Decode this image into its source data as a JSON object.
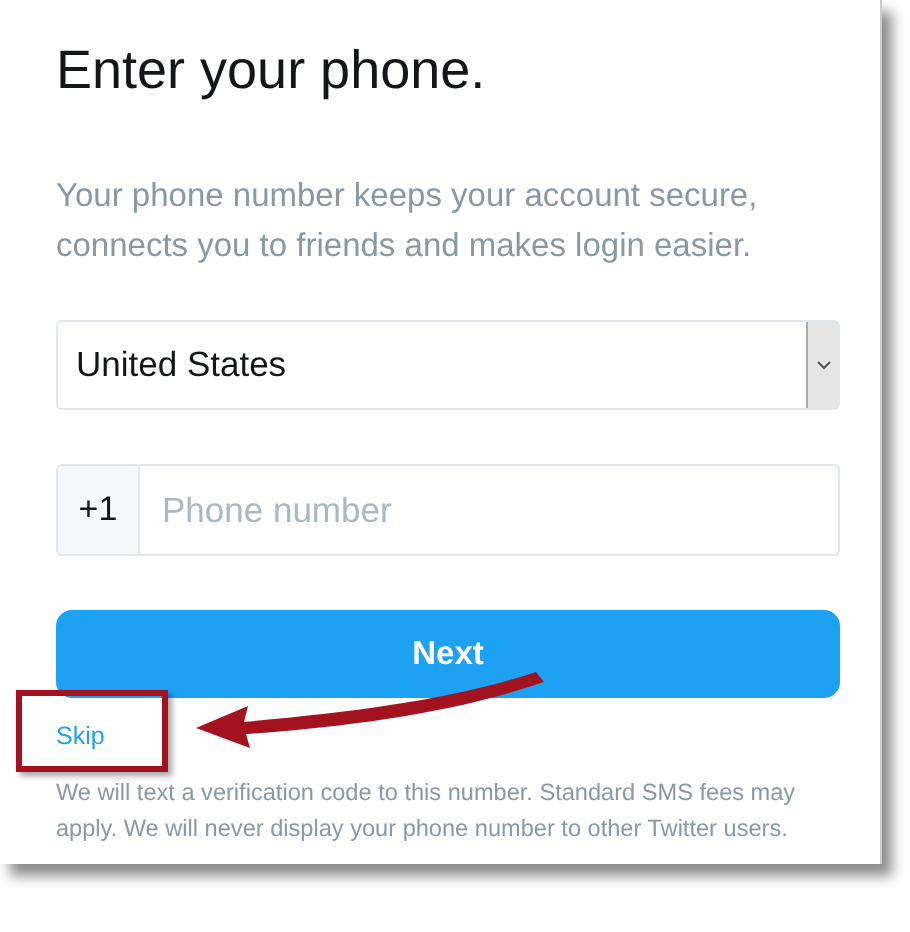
{
  "title": "Enter your phone.",
  "subtitle": "Your phone number keeps your account secure, connects you to friends and makes login easier.",
  "country_select": {
    "value": "United States"
  },
  "phone_field": {
    "prefix": "+1",
    "placeholder": "Phone number"
  },
  "next_button": "Next",
  "skip_link": "Skip",
  "note": "We will text a verification code to this number. Standard SMS fees may apply. We will never display your phone number to other Twitter users."
}
